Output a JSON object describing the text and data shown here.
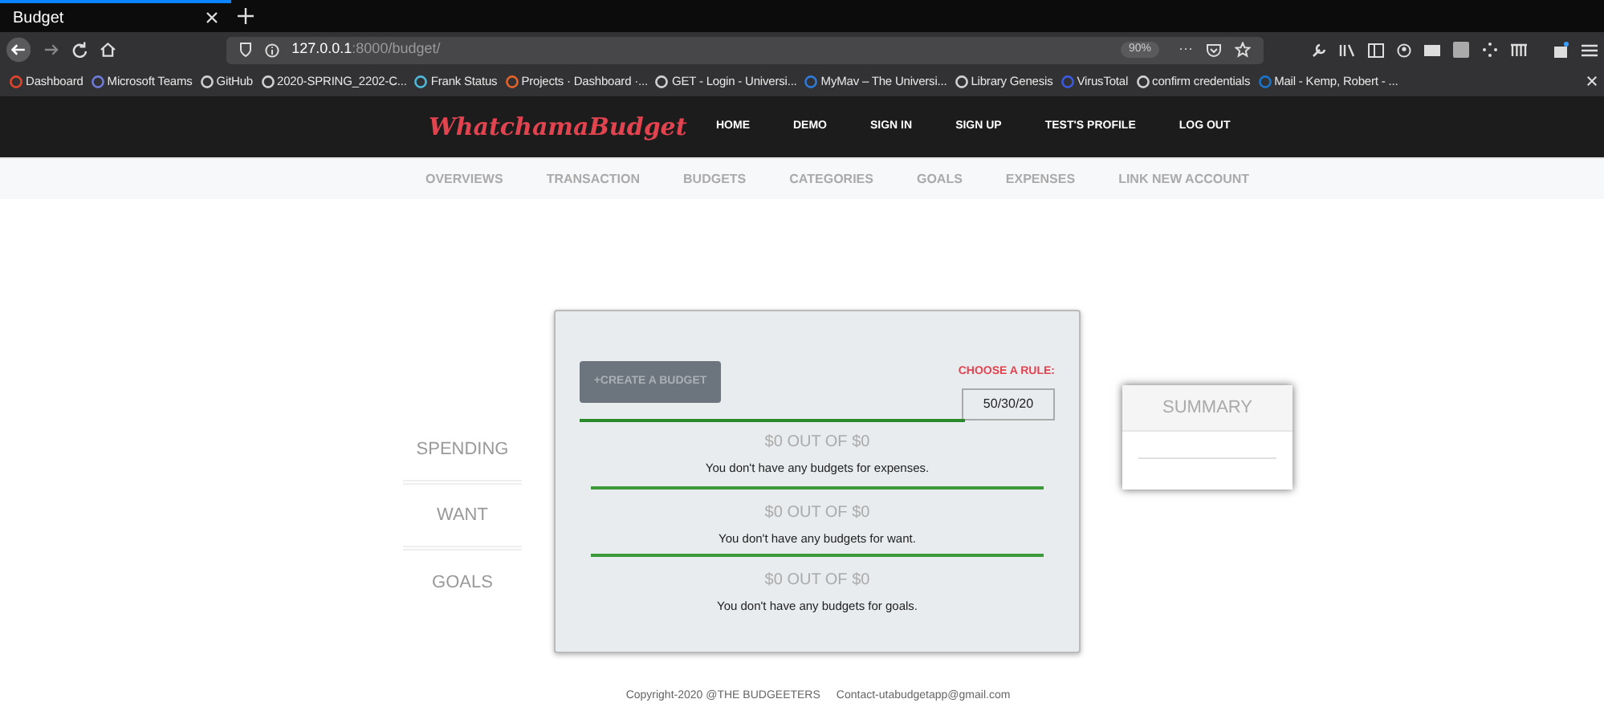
{
  "browser": {
    "tab": {
      "title": "Budget",
      "selected": true
    },
    "url": {
      "host": "127.0.0.1",
      "path": ":8000/budget/"
    },
    "zoom": "90%",
    "more": "···",
    "bookmarks": [
      {
        "label": "Dashboard",
        "color": "#e0452b"
      },
      {
        "label": "Microsoft Teams",
        "color": "#6e7ad8"
      },
      {
        "label": "GitHub",
        "color": "#d0d0d0"
      },
      {
        "label": "2020-SPRING_2202-C...",
        "color": "#d0d0d0"
      },
      {
        "label": "Frank Status",
        "color": "#4fb8d8"
      },
      {
        "label": "Projects · Dashboard ·...",
        "color": "#e2632a"
      },
      {
        "label": "GET - Login - Universi...",
        "color": "#d0d0d0"
      },
      {
        "label": "MyMav – The Universi...",
        "color": "#2f7ad8"
      },
      {
        "label": "Library Genesis",
        "color": "#d0d0d0"
      },
      {
        "label": "VirusTotal",
        "color": "#3b5ae0"
      },
      {
        "label": "confirm credentials",
        "color": "#d0d0d0"
      },
      {
        "label": "Mail - Kemp, Robert - ...",
        "color": "#1a73c8"
      }
    ]
  },
  "site": {
    "logo": "WhatchamaBudget",
    "nav": [
      "HOME",
      "DEMO",
      "SIGN IN",
      "SIGN UP",
      "TEST'S PROFILE",
      "LOG OUT"
    ],
    "subnav": [
      "OVERVIEWS",
      "TRANSACTION",
      "BUDGETS",
      "CATEGORIES",
      "GOALS",
      "EXPENSES",
      "LINK NEW ACCOUNT"
    ]
  },
  "side_labels": [
    "SPENDING",
    "WANT",
    "GOALS"
  ],
  "budget_card": {
    "create_button": "+CREATE A BUDGET",
    "rule_label": "CHOOSE A RULE:",
    "rule_value": "50/30/20",
    "sections": [
      {
        "total": "$0 OUT OF $0",
        "message": "You don't have any budgets for expenses."
      },
      {
        "total": "$0 OUT OF $0",
        "message": "You don't have any budgets for want."
      },
      {
        "total": "$0 OUT OF $0",
        "message": "You don't have any budgets for goals."
      }
    ]
  },
  "summary": {
    "title": "SUMMARY"
  },
  "footer": {
    "copyright": "Copyright-2020 @THE BUDGEETERS",
    "contact": "Contact-utabudgetapp@gmail.com"
  }
}
